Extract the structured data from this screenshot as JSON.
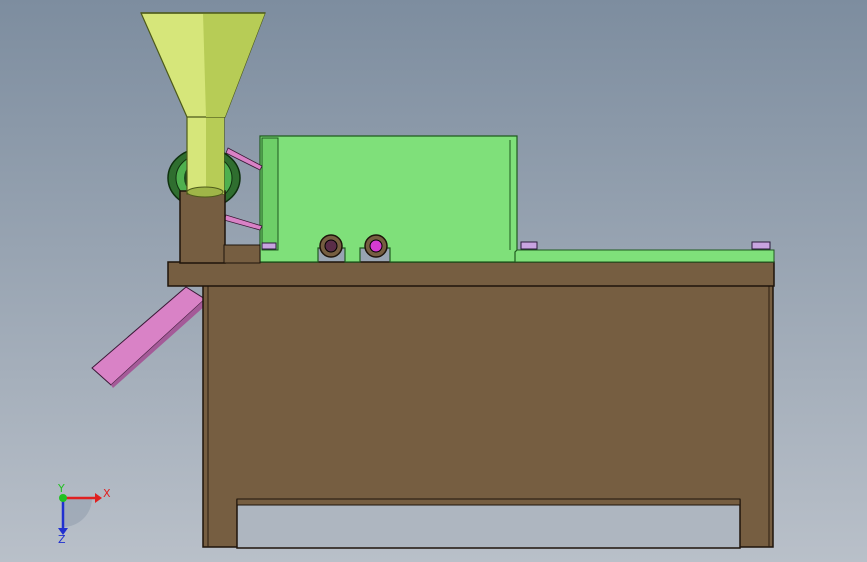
{
  "viewport": {
    "colors": {
      "bg_top": "#7d8d9f",
      "bg_bottom": "#b9c0c9"
    }
  },
  "model": {
    "colors": {
      "frame": "#765e41",
      "frame_edge": "#1e140a",
      "body_light": "#c9c06a",
      "hopper": "#d6e67a",
      "hopper_dark": "#9fb548",
      "tank": "#7fe07a",
      "tank_edge": "#1f5a1f",
      "chute": "#d982c6",
      "chute_dark": "#a45a98",
      "bolt": "#c8a4e0",
      "roller_ring": "#3c9a3c",
      "bearing": "#d63bd0"
    }
  },
  "triad": {
    "x_label": "X",
    "y_label": "Y",
    "z_label": "Z",
    "colors": {
      "x": "#e02020",
      "y": "#22c022",
      "z": "#2030d0"
    }
  }
}
